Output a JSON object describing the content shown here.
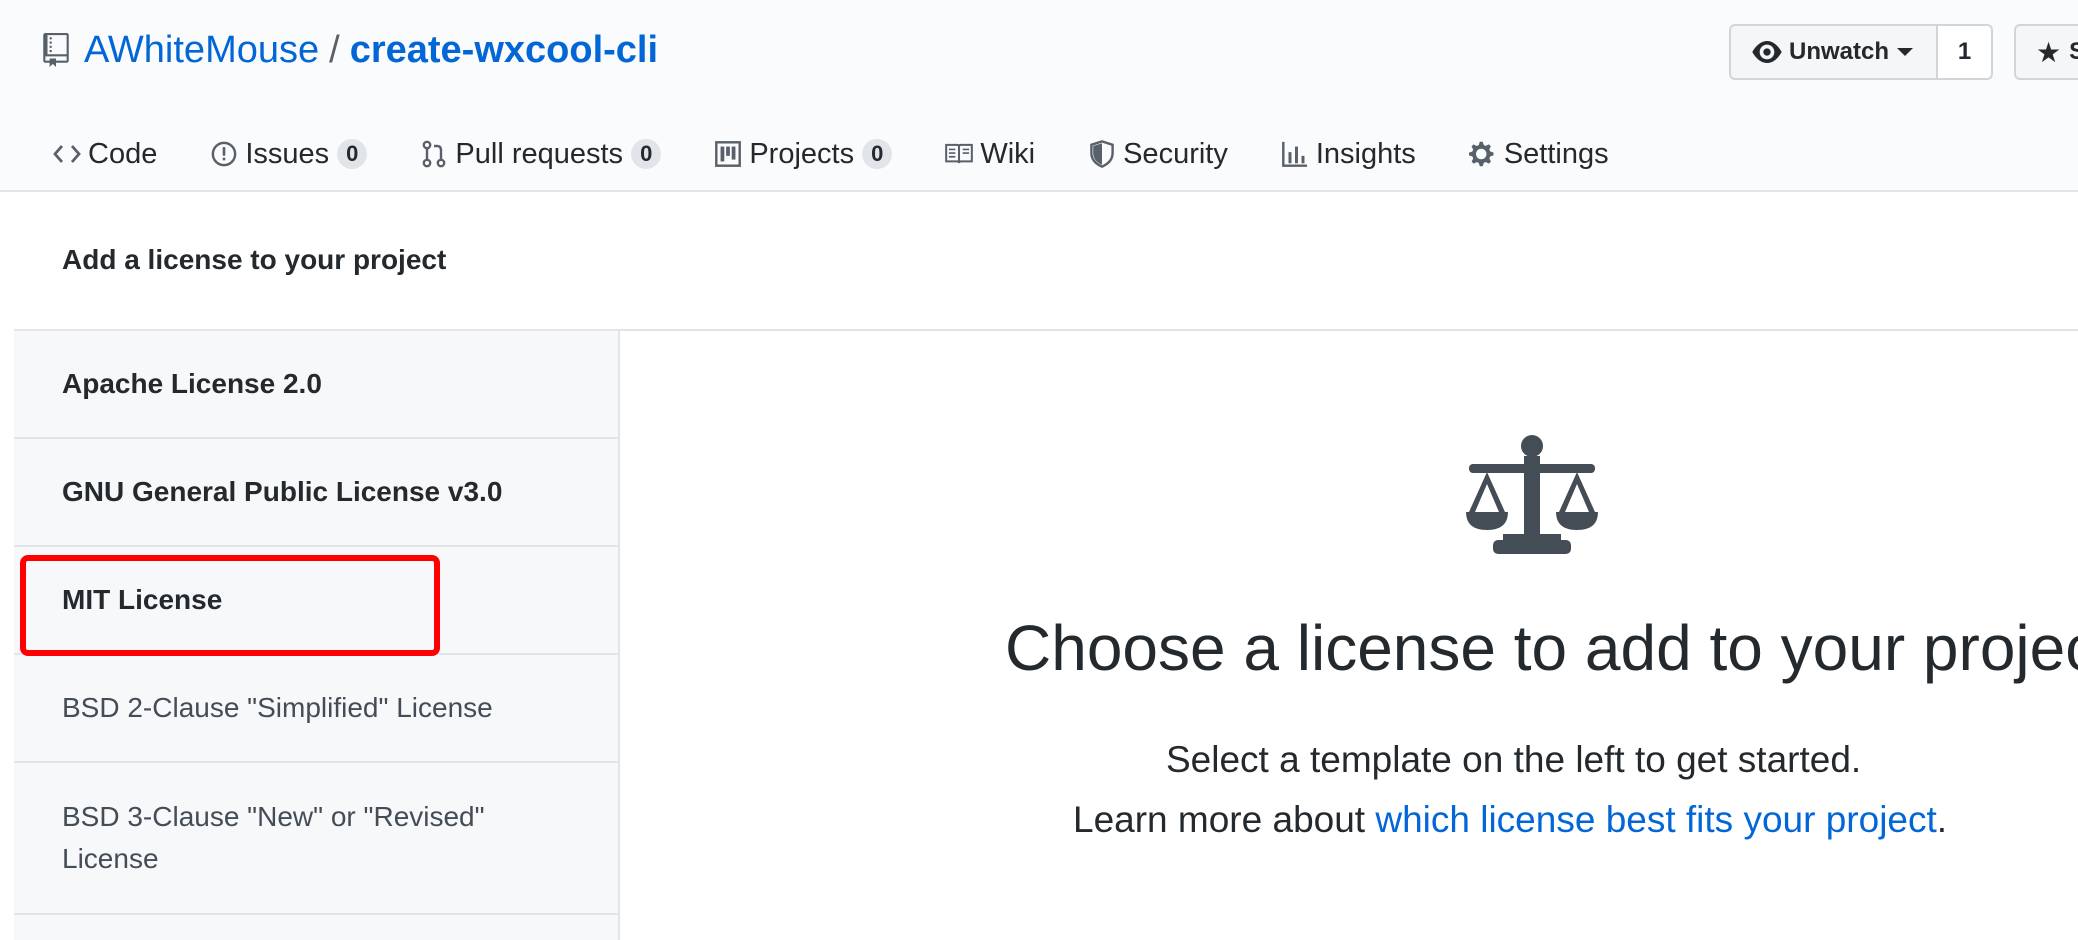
{
  "repo": {
    "owner": "AWhiteMouse",
    "separator": "/",
    "name": "create-wxcool-cli",
    "icon": "repo-icon"
  },
  "actions": {
    "unwatch_label": "Unwatch",
    "watch_count": "1",
    "star_label": "S"
  },
  "tabs": [
    {
      "label": "Code",
      "icon": "code-icon"
    },
    {
      "label": "Issues",
      "count": "0",
      "icon": "issue-icon"
    },
    {
      "label": "Pull requests",
      "count": "0",
      "icon": "pull-request-icon"
    },
    {
      "label": "Projects",
      "count": "0",
      "icon": "project-icon"
    },
    {
      "label": "Wiki",
      "icon": "book-icon"
    },
    {
      "label": "Security",
      "icon": "shield-icon"
    },
    {
      "label": "Insights",
      "icon": "graph-icon"
    },
    {
      "label": "Settings",
      "icon": "gear-icon"
    }
  ],
  "section_title": "Add a license to your project",
  "licenses": [
    {
      "label": "Apache License 2.0"
    },
    {
      "label": "GNU General Public License v3.0"
    },
    {
      "label": "MIT License"
    },
    {
      "label": "BSD 2-Clause \"Simplified\" License"
    },
    {
      "label": "BSD 3-Clause \"New\" or \"Revised\" License"
    }
  ],
  "empty_state": {
    "icon": "law-icon",
    "heading": "Choose a license to add to your project",
    "line1": "Select a template on the left to get started.",
    "line2_prefix": "Learn more about ",
    "line2_link": "which license best fits your project",
    "line2_suffix": "."
  },
  "colors": {
    "link": "#0366d6",
    "highlight": "#ff0000",
    "sidebar_bg": "#f6f8fa",
    "header_bg": "#fafbfc"
  }
}
